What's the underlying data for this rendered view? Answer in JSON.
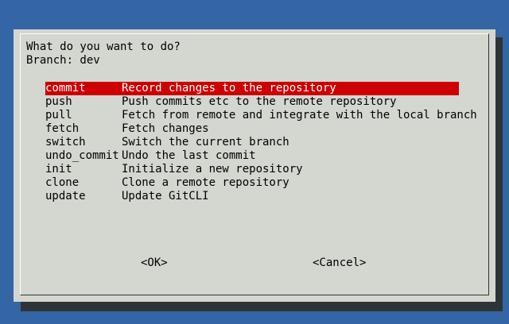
{
  "dialog": {
    "prompt": "What do you want to do?",
    "branch_line": "Branch: dev"
  },
  "menu": {
    "items": [
      {
        "tag": "commit",
        "description": "Record changes to the repository"
      },
      {
        "tag": "push",
        "description": "Push commits etc to the remote repository"
      },
      {
        "tag": "pull",
        "description": "Fetch from remote and integrate with the local branch"
      },
      {
        "tag": "fetch",
        "description": "Fetch changes"
      },
      {
        "tag": "switch",
        "description": "Switch the current branch"
      },
      {
        "tag": "undo_commit",
        "description": "Undo the last commit"
      },
      {
        "tag": "init",
        "description": "Initialize a new repository"
      },
      {
        "tag": "clone",
        "description": "Clone a remote repository"
      },
      {
        "tag": "update",
        "description": "Update GitCLI"
      }
    ],
    "selected_index": 0
  },
  "buttons": {
    "ok_label": "<OK>",
    "cancel_label": "<Cancel>"
  },
  "colors": {
    "desktop": "#3465a4",
    "dialog": "#d3d7cf",
    "highlight": "#cc0000",
    "highlight_text": "#ffffff",
    "shadow": "#2e3436"
  }
}
